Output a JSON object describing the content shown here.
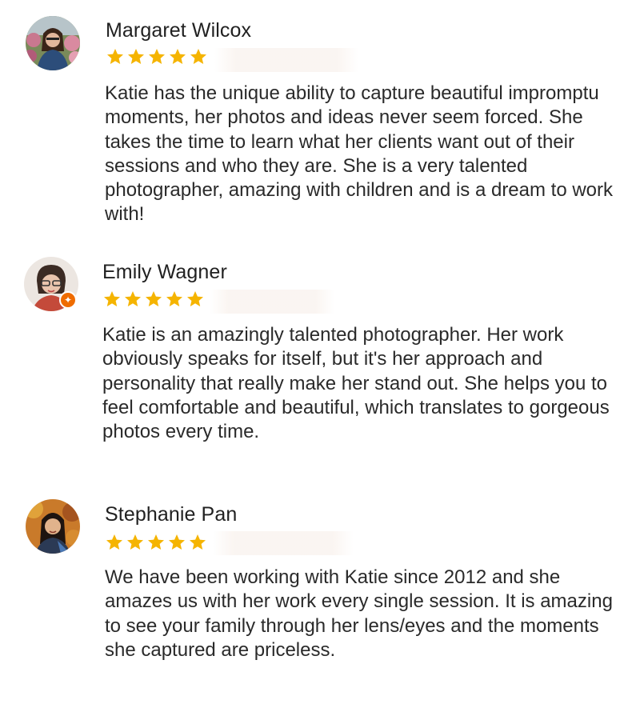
{
  "reviews": [
    {
      "name": "Margaret Wilcox",
      "rating": 5,
      "avatar_icon": "profile-photo",
      "text": "Katie has the unique ability to capture beautiful impromptu moments, her photos and ideas never seem forced. She takes the time to learn what her clients want out of their sessions and who they are. She is a very talented photographer, amazing with children and is a dream to work with!"
    },
    {
      "name": "Emily Wagner",
      "rating": 5,
      "avatar_icon": "profile-photo",
      "badge_icon": "local-guide-badge-icon",
      "text": "Katie is an amazingly talented photographer. Her work obviously speaks for itself, but it's her approach and personality that really make her stand out. She helps you to feel comfortable and beautiful, which translates to gorgeous photos every time."
    },
    {
      "name": "Stephanie Pan",
      "rating": 5,
      "avatar_icon": "profile-photo",
      "text": "We have been working with Katie since 2012 and she amazes us with her work every single session. It is amazing to see your family through her lens/eyes and the moments she captured are priceless."
    }
  ],
  "colors": {
    "star": "#f5b400",
    "name": "#212121",
    "text": "#2a2a2a",
    "badge": "#ef6c00"
  }
}
